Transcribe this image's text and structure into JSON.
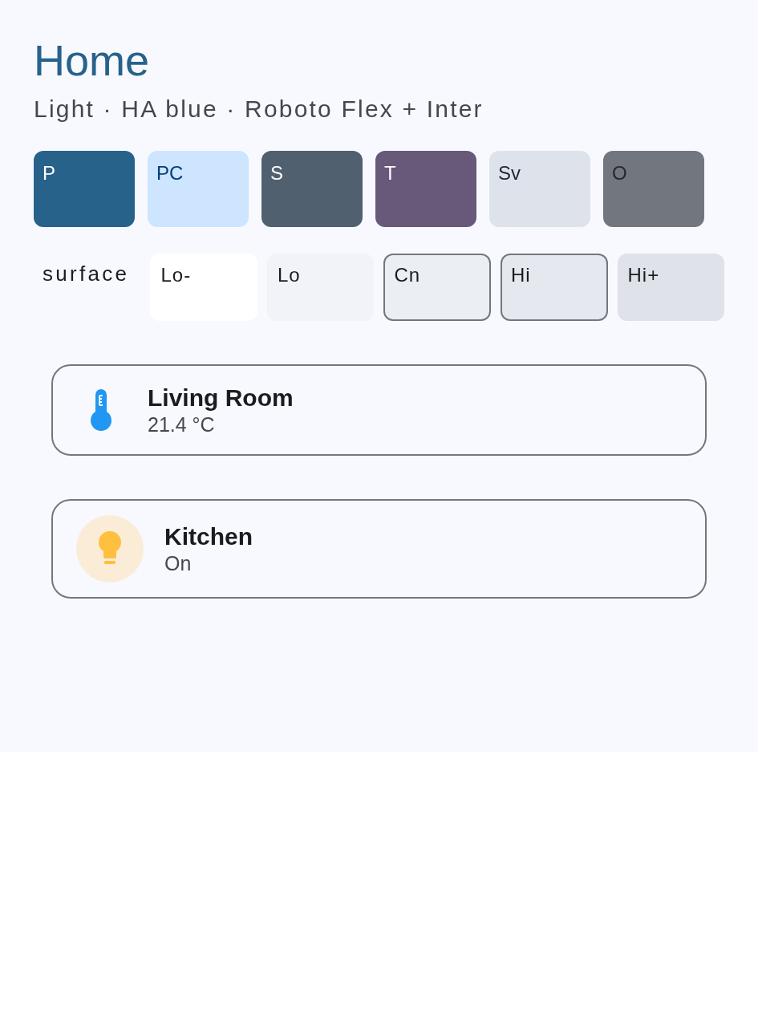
{
  "header": {
    "title": "Home",
    "subtitle": "Light · HA blue · Roboto Flex + Inter"
  },
  "color_roles": [
    {
      "label": "P",
      "color": "#27628a"
    },
    {
      "label": "PC",
      "color": "#cde5ff"
    },
    {
      "label": "S",
      "color": "#51606f"
    },
    {
      "label": "T",
      "color": "#68587a"
    },
    {
      "label": "Sv",
      "color": "#dee3eb"
    },
    {
      "label": "O",
      "color": "#72777f"
    }
  ],
  "surface": {
    "label": "surface",
    "levels": [
      {
        "label": "Lo-",
        "color": "#ffffff",
        "outlined": false
      },
      {
        "label": "Lo",
        "color": "#f1f3f9",
        "outlined": false
      },
      {
        "label": "Cn",
        "color": "#ebeef3",
        "outlined": true
      },
      {
        "label": "Hi",
        "color": "#e5e8ee",
        "outlined": true
      },
      {
        "label": "Hi+",
        "color": "#dfe2e8",
        "outlined": false
      }
    ]
  },
  "tiles": [
    {
      "kind": "sensor",
      "name": "Living Room",
      "state": "21.4 °C"
    },
    {
      "kind": "light",
      "name": "Kitchen",
      "state": "On"
    }
  ]
}
